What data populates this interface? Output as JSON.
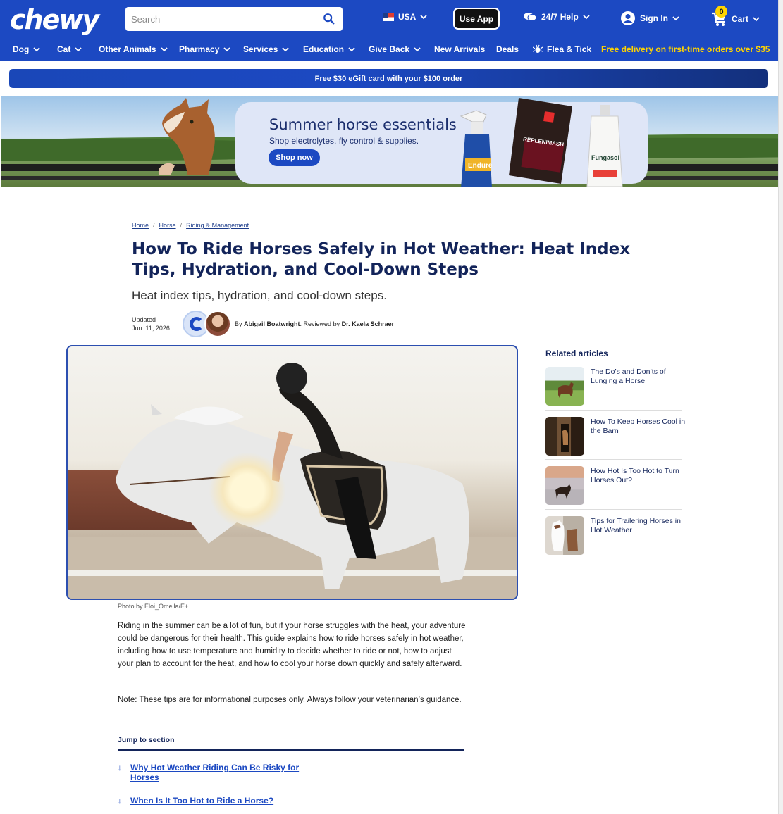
{
  "header": {
    "logo": "chewy",
    "search_placeholder": "Search",
    "country": "USA",
    "use_app": "Use App",
    "help": "24/7 Help",
    "sign_in": "Sign In",
    "cart_label": "Cart",
    "cart_count": "0"
  },
  "nav": {
    "items": [
      "Dog",
      "Cat",
      "Other Animals",
      "Pharmacy",
      "Services",
      "Education",
      "Give Back",
      "New Arrivals",
      "Deals",
      "Flea & Tick"
    ],
    "promo": "Free delivery on first-time orders over $35"
  },
  "gift_bar": "Free $30 eGift card with your $100 order",
  "hero": {
    "title": "Summer horse essentials",
    "subtitle": "Shop electrolytes, fly control & supplies.",
    "button": "Shop now",
    "products": [
      "Endure",
      "REPLENIMASH",
      "Fungasol"
    ]
  },
  "breadcrumb": [
    "Home",
    "Horse",
    "Riding & Management"
  ],
  "article": {
    "title": "How To Ride Horses Safely in Hot Weather: Heat Index Tips, Hydration, and Cool-Down Steps",
    "subtitle": "Heat index tips, hydration, and cool-down steps.",
    "updated_label": "Updated",
    "updated_date": "Jun. 11, 2026",
    "by": "By",
    "author": "Abigail Boatwright",
    "reviewed_by": "Reviewed by",
    "reviewer": "Dr. Kaela Schraer",
    "photo_credit": "Photo by Eloi_Omella/E+",
    "intro": "Riding in the summer can be a lot of fun, but if your horse struggles with the heat, your adventure could be dangerous for their health. This guide explains how to ride horses safely in hot weather, including how to use temperature and humidity to decide whether to ride or not, how to adjust your plan to account for the heat, and how to cool your horse down quickly and safely afterward.",
    "note": "Note: These tips are for informational purposes only. Always follow your veterinarian’s guidance.",
    "jump_heading": "Jump to section",
    "jump_links": [
      "Why Hot Weather Riding Can Be Risky for Horses",
      "When Is It Too Hot to Ride a Horse?"
    ]
  },
  "related": {
    "heading": "Related articles",
    "items": [
      "The Do’s and Don’ts of Lunging a Horse",
      "How To Keep Horses Cool in the Barn",
      "How Hot Is Too Hot to Turn Horses Out?",
      "Tips for Trailering Horses in Hot Weather"
    ]
  }
}
